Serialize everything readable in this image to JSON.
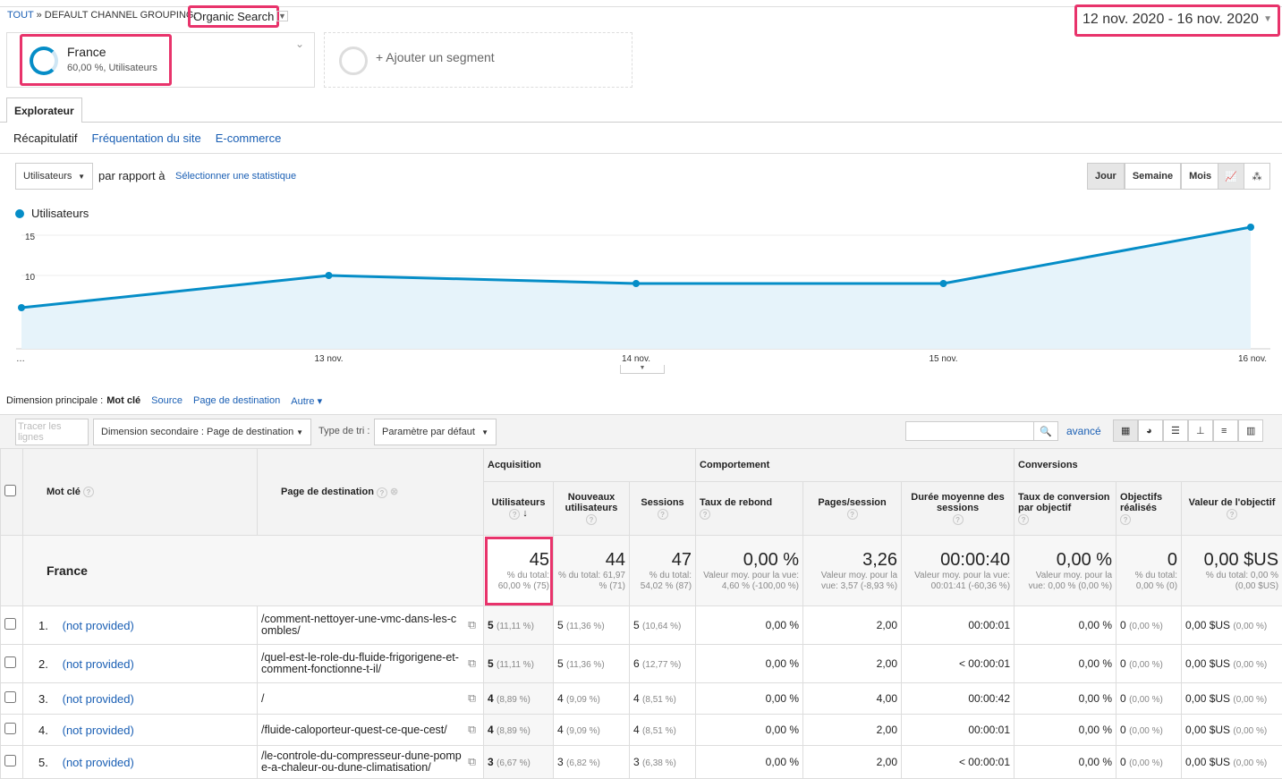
{
  "breadcrumb": {
    "all": "TOUT",
    "sep": "»",
    "grouping": "DEFAULT CHANNEL GROUPING:",
    "channel": "Organic Search"
  },
  "date_range": "12 nov. 2020 - 16 nov. 2020",
  "segment": {
    "name": "France",
    "detail": "60,00 %, Utilisateurs",
    "add": "+ Ajouter un segment"
  },
  "tabs": {
    "explorer": "Explorateur"
  },
  "subtabs": [
    "Récapitulatif",
    "Fréquentation du site",
    "E-commerce"
  ],
  "controls": {
    "metric": "Utilisateurs",
    "vs": "par rapport à",
    "select_metric": "Sélectionner une statistique",
    "periods": [
      "Jour",
      "Semaine",
      "Mois"
    ],
    "active_period": "Jour"
  },
  "chart_data": {
    "type": "area",
    "series": [
      {
        "name": "Utilisateurs",
        "values": [
          6,
          10,
          9,
          9,
          16
        ]
      }
    ],
    "categories": [
      "12 nov.",
      "13 nov.",
      "14 nov.",
      "15 nov.",
      "16 nov."
    ],
    "x_tick_labels": [
      "…",
      "13 nov.",
      "14 nov.",
      "15 nov.",
      "16 nov."
    ],
    "y_ticks": [
      "5",
      "10",
      "15"
    ],
    "ylim": [
      3,
      17
    ],
    "color": "#058dc7",
    "grid": true,
    "legend": "top-left"
  },
  "dimension": {
    "label": "Dimension principale :",
    "active": "Mot clé",
    "others": [
      "Source",
      "Page de destination",
      "Autre"
    ]
  },
  "toolbar": {
    "plot_rows": "Tracer les lignes",
    "secondary": "Dimension secondaire : Page de destination",
    "sort_label": "Type de tri :",
    "sort": "Paramètre par défaut",
    "advanced": "avancé",
    "search_value": ""
  },
  "table": {
    "groups": [
      "Acquisition",
      "Comportement",
      "Conversions"
    ],
    "headers": [
      "Mot clé",
      "Page de destination",
      "Utilisateurs",
      "Nouveaux utilisateurs",
      "Sessions",
      "Taux de rebond",
      "Pages/session",
      "Durée moyenne des sessions",
      "Taux de conversion par objectif",
      "Objectifs réalisés",
      "Valeur de l'objectif"
    ],
    "total": {
      "label": "France",
      "cells": [
        {
          "v": "45",
          "s": "% du total: 60,00 % (75)"
        },
        {
          "v": "44",
          "s": "% du total: 61,97 % (71)"
        },
        {
          "v": "47",
          "s": "% du total: 54,02 % (87)"
        },
        {
          "v": "0,00 %",
          "s": "Valeur moy. pour la vue: 4,60 % (-100,00 %)"
        },
        {
          "v": "3,26",
          "s": "Valeur moy. pour la vue: 3,57 (-8,93 %)"
        },
        {
          "v": "00:00:40",
          "s": "Valeur moy. pour la vue: 00:01:41 (-60,36 %)"
        },
        {
          "v": "0,00 %",
          "s": "Valeur moy. pour la vue: 0,00 % (0,00 %)"
        },
        {
          "v": "0",
          "s": "% du total: 0,00 % (0)"
        },
        {
          "v": "0,00 $US",
          "s": "% du total: 0,00 % (0,00 $US)"
        }
      ]
    },
    "rows": [
      {
        "n": "1.",
        "kw": "(not provided)",
        "page": "/comment-nettoyer-une-vmc-dans-les-combles/",
        "u": "5",
        "up": "(11,11 %)",
        "nu": "5",
        "nup": "(11,36 %)",
        "s": "5",
        "sp": "(10,64 %)",
        "br": "0,00 %",
        "ps": "2,00",
        "d": "00:00:01",
        "cr": "0,00 %",
        "g": "0",
        "gp": "(0,00 %)",
        "val": "0,00 $US",
        "vp": "(0,00 %)"
      },
      {
        "n": "2.",
        "kw": "(not provided)",
        "page": "/quel-est-le-role-du-fluide-frigorigene-et-comment-fonctionne-t-il/",
        "u": "5",
        "up": "(11,11 %)",
        "nu": "5",
        "nup": "(11,36 %)",
        "s": "6",
        "sp": "(12,77 %)",
        "br": "0,00 %",
        "ps": "2,00",
        "d": "< 00:00:01",
        "cr": "0,00 %",
        "g": "0",
        "gp": "(0,00 %)",
        "val": "0,00 $US",
        "vp": "(0,00 %)"
      },
      {
        "n": "3.",
        "kw": "(not provided)",
        "page": "/",
        "u": "4",
        "up": "(8,89 %)",
        "nu": "4",
        "nup": "(9,09 %)",
        "s": "4",
        "sp": "(8,51 %)",
        "br": "0,00 %",
        "ps": "4,00",
        "d": "00:00:42",
        "cr": "0,00 %",
        "g": "0",
        "gp": "(0,00 %)",
        "val": "0,00 $US",
        "vp": "(0,00 %)"
      },
      {
        "n": "4.",
        "kw": "(not provided)",
        "page": "/fluide-caloporteur-quest-ce-que-cest/",
        "u": "4",
        "up": "(8,89 %)",
        "nu": "4",
        "nup": "(9,09 %)",
        "s": "4",
        "sp": "(8,51 %)",
        "br": "0,00 %",
        "ps": "2,00",
        "d": "00:00:01",
        "cr": "0,00 %",
        "g": "0",
        "gp": "(0,00 %)",
        "val": "0,00 $US",
        "vp": "(0,00 %)"
      },
      {
        "n": "5.",
        "kw": "(not provided)",
        "page": "/le-controle-du-compresseur-dune-pompe-a-chaleur-ou-dune-climatisation/",
        "u": "3",
        "up": "(6,67 %)",
        "nu": "3",
        "nup": "(6,82 %)",
        "s": "3",
        "sp": "(6,38 %)",
        "br": "0,00 %",
        "ps": "2,00",
        "d": "< 00:00:01",
        "cr": "0,00 %",
        "g": "0",
        "gp": "(0,00 %)",
        "val": "0,00 $US",
        "vp": "(0,00 %)"
      }
    ]
  }
}
